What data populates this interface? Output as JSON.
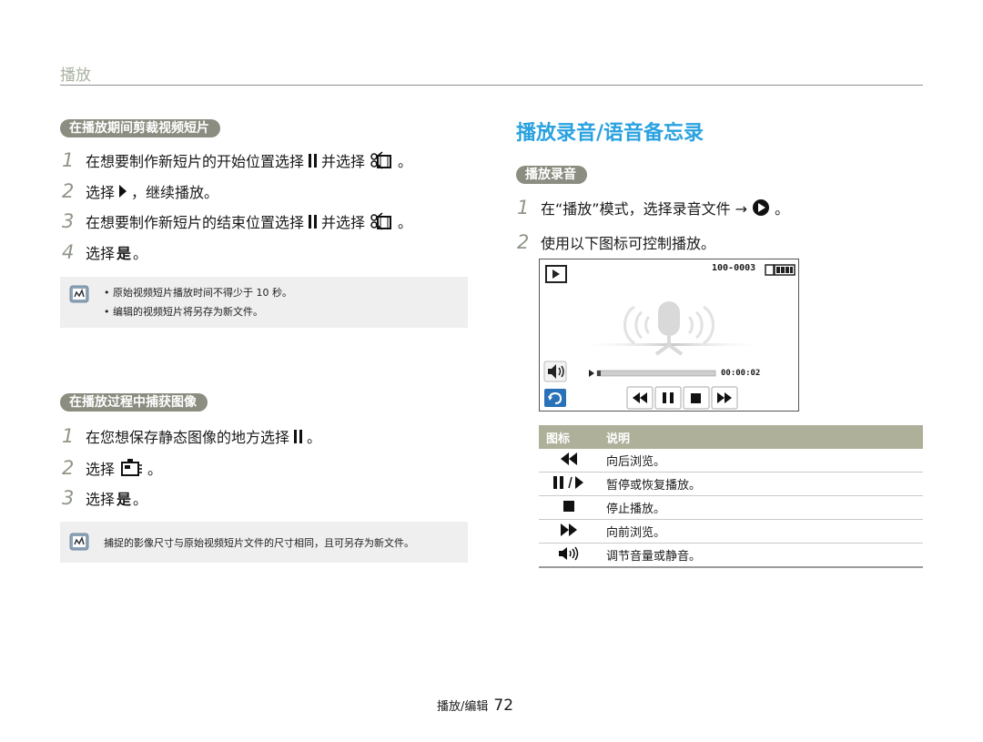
{
  "header": {
    "title": "播放"
  },
  "left": {
    "section1": {
      "pill": "在播放期间剪裁视频短片",
      "steps": [
        {
          "num": "1",
          "pre": "在想要制作新短片的开始位置选择",
          "mid": "并选择",
          "post": "。"
        },
        {
          "num": "2",
          "pre": "选择",
          "post": "，继续播放。"
        },
        {
          "num": "3",
          "pre": "在想要制作新短片的结束位置选择",
          "mid": "并选择",
          "post": "。"
        },
        {
          "num": "4",
          "pre": "选择",
          "bold": "是",
          "post": "。"
        }
      ],
      "notes": [
        "原始视频短片播放时间不得少于 10 秒。",
        "编辑的视频短片将另存为新文件。"
      ]
    },
    "section2": {
      "pill": "在播放过程中捕获图像",
      "steps": [
        {
          "num": "1",
          "pre": "在您想保存静态图像的地方选择",
          "post": "。"
        },
        {
          "num": "2",
          "pre": "选择",
          "post": "。"
        },
        {
          "num": "3",
          "pre": "选择",
          "bold": "是",
          "post": "。"
        }
      ],
      "note": "捕捉的影像尺寸与原始视频短片文件的尺寸相同，且可另存为新文件。"
    }
  },
  "right": {
    "title": "播放录音/语音备忘录",
    "pill": "播放录音",
    "steps": [
      {
        "num": "1",
        "pre": "在“播放”模式，选择录音文件 →",
        "post": "。"
      },
      {
        "num": "2",
        "text": "使用以下图标可控制播放。"
      }
    ],
    "screen": {
      "file_number": "100-0003",
      "time": "00:00:02"
    },
    "table": {
      "headers": [
        "图标",
        "说明"
      ],
      "rows": [
        {
          "icon": "rewind-icon",
          "desc": "向后浏览。"
        },
        {
          "icon": "pause-play-icon",
          "desc": "暂停或恢复播放。"
        },
        {
          "icon": "stop-icon",
          "desc": "停止播放。"
        },
        {
          "icon": "fast-forward-icon",
          "desc": "向前浏览。"
        },
        {
          "icon": "volume-icon",
          "desc": "调节音量或静音。"
        }
      ]
    }
  },
  "footer": {
    "label": "播放/编辑",
    "page": "72"
  }
}
